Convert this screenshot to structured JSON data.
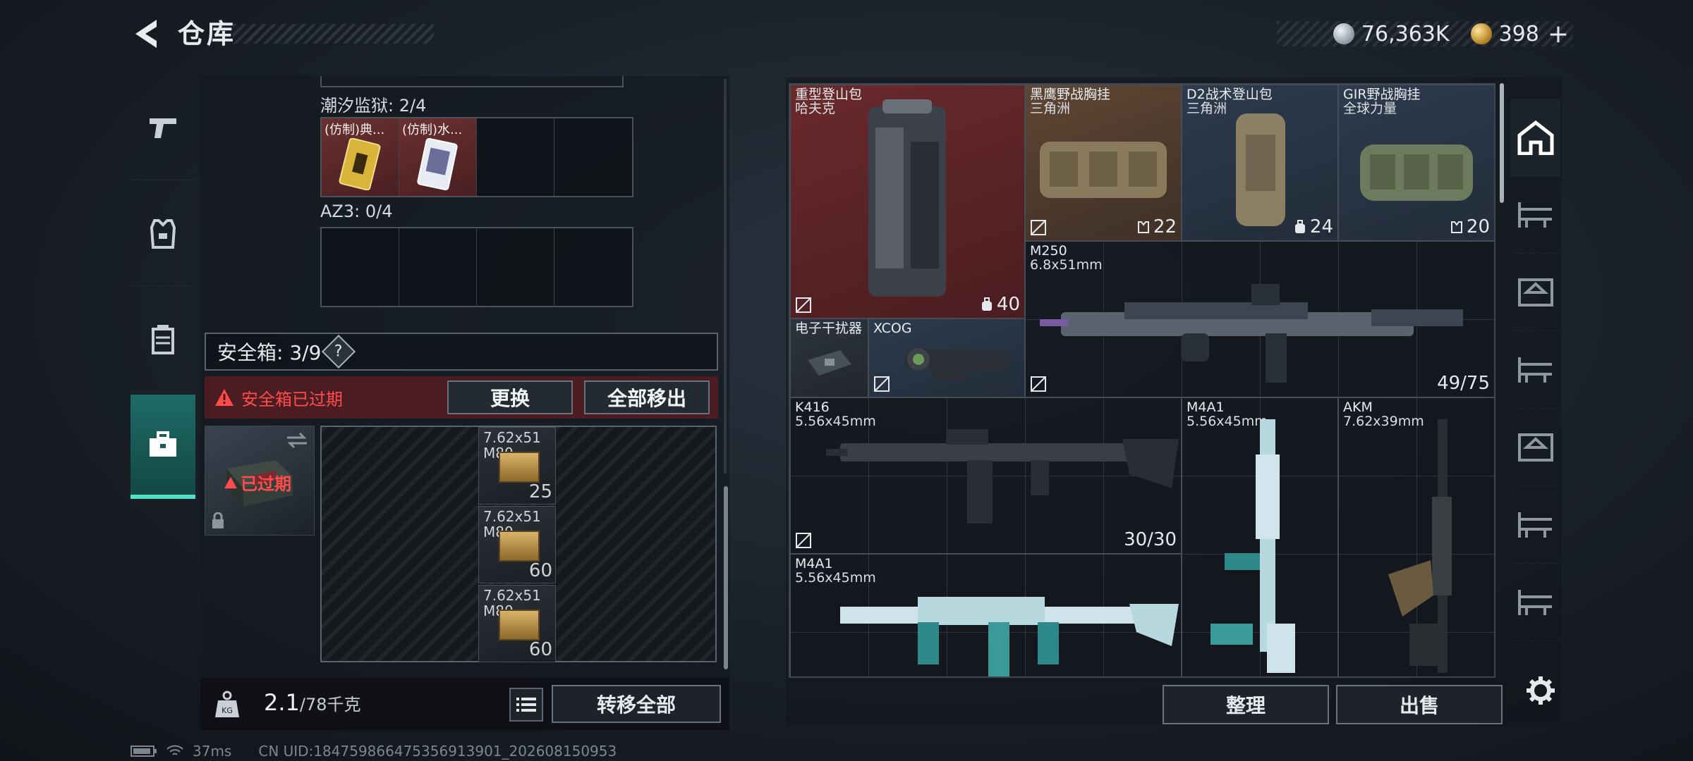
{
  "header": {
    "title": "仓库",
    "silver_amount": "76,363K",
    "gold_amount": "398",
    "plus_label": "+"
  },
  "colors": {
    "accent": "#4fe0c6",
    "expired_red": "#ff4b4b",
    "rare_red": "#6a2a2c"
  },
  "left_tabs": [
    {
      "name": "weapon-tab",
      "icon": "pistol-icon"
    },
    {
      "name": "gear-tab",
      "icon": "vest-icon"
    },
    {
      "name": "consumable-tab",
      "icon": "canister-icon"
    },
    {
      "name": "safebox-tab",
      "icon": "briefcase-icon",
      "active": true
    }
  ],
  "containers": {
    "tide_prison_label": "潮汐监狱: 2/4",
    "tide_items": [
      "(仿制)典...",
      "(仿制)水..."
    ],
    "az3_label": "AZ3: 0/4"
  },
  "safebox": {
    "label": "安全箱: 3/9",
    "help": "?",
    "expired_notice": "安全箱已过期",
    "replace_label": "更换",
    "remove_all_label": "全部移出",
    "tile_status": "已过期",
    "ammo": [
      {
        "caliber": "7.62x51",
        "type": "M80",
        "count": "25"
      },
      {
        "caliber": "7.62x51",
        "type": "M80",
        "count": "60"
      },
      {
        "caliber": "7.62x51",
        "type": "M80",
        "count": "60"
      }
    ]
  },
  "footer_left": {
    "weight_value": "2.1",
    "weight_unit": "/78千克",
    "transfer_all_label": "转移全部"
  },
  "status": {
    "ping": "37ms",
    "uid": "CN UID:1847598664753569139​01_202608150953"
  },
  "inventory": {
    "items": [
      {
        "name": "重型登山包",
        "sub": "哈夫克",
        "count": "40"
      },
      {
        "name": "黑鹰野战胸挂",
        "sub": "三角洲",
        "count": "22"
      },
      {
        "name": "D2战术登山包",
        "sub": "三角洲",
        "count": "24"
      },
      {
        "name": "GIR野战胸挂",
        "sub": "全球力量",
        "count": "20"
      },
      {
        "name": "M250",
        "sub": "6.8x51mm",
        "count": "49/75"
      },
      {
        "name": "电子干扰器",
        "sub": "",
        "count": ""
      },
      {
        "name": "XCOG",
        "sub": "",
        "count": ""
      },
      {
        "name": "K416",
        "sub": "5.56x45mm",
        "count": "30/30"
      },
      {
        "name": "M4A1",
        "sub": "5.56x45mm",
        "count": ""
      },
      {
        "name": "AKM",
        "sub": "7.62x39mm",
        "count": ""
      },
      {
        "name": "M4A1",
        "sub": "5.56x45mm",
        "count": ""
      }
    ],
    "sort_label": "整理",
    "sell_label": "出售"
  }
}
